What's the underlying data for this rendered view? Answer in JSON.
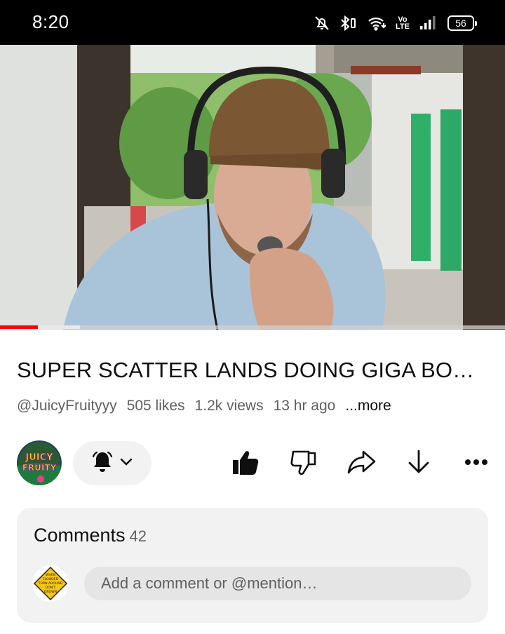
{
  "status_bar": {
    "time": "8:20",
    "volte_top": "Vo",
    "volte_bottom": "LTE",
    "battery": "56",
    "icons": [
      "bell-off-icon",
      "bluetooth-icon",
      "wifi-icon",
      "volte-icon",
      "signal-icon",
      "battery-icon"
    ]
  },
  "video": {
    "progress_played": 0.075,
    "progress_buffered": 0.158,
    "title": "SUPER SCATTER LANDS DOING GIGA BONUS BUY",
    "channel_handle": "@JuicyFruityyy",
    "likes": "505 likes",
    "views": "1.2k views",
    "age": "13 hr ago",
    "more": "...more"
  },
  "channel": {
    "avatar_text_1": "JUICY",
    "avatar_text_2": "FRUITY"
  },
  "actions": {
    "icons": [
      "bell-icon",
      "chevron-down-icon",
      "like-icon",
      "dislike-icon",
      "share-icon",
      "download-icon",
      "more-icon"
    ]
  },
  "comments": {
    "label": "Comments",
    "count": "42",
    "placeholder": "Add a comment or @mention…",
    "avatar_lines": [
      "WHEN",
      "FLOODED",
      "TURN AROUND",
      "DON'T",
      "DROWN"
    ]
  },
  "colors": {
    "progress": "#ff0000",
    "pill": "#f2f2f2",
    "card": "#f2f2f2",
    "muted_text": "#606060",
    "sign_yellow": "#f5c518"
  }
}
